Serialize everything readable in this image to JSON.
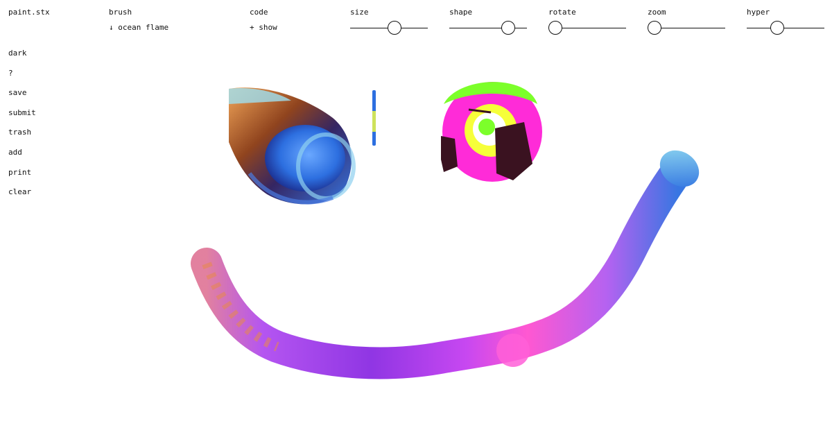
{
  "app": {
    "title": "paint.stx"
  },
  "toolbar": {
    "brush": {
      "label": "brush",
      "value": "↓ ocean flame"
    },
    "code": {
      "label": "code",
      "value": "+ show"
    },
    "sliders": [
      {
        "id": "size",
        "label": "size",
        "value": 0.48
      },
      {
        "id": "shape",
        "label": "shape",
        "value": 0.67
      },
      {
        "id": "rotate",
        "label": "rotate",
        "value": 0.0
      },
      {
        "id": "zoom",
        "label": "zoom",
        "value": 0.0
      },
      {
        "id": "hyper",
        "label": "hyper",
        "value": 0.3
      }
    ]
  },
  "menu": [
    {
      "id": "dark",
      "label": "dark"
    },
    {
      "id": "help",
      "label": "?"
    },
    {
      "id": "save",
      "label": "save"
    },
    {
      "id": "submit",
      "label": "submit"
    },
    {
      "id": "trash",
      "label": "trash"
    },
    {
      "id": "add",
      "label": "add"
    },
    {
      "id": "print",
      "label": "print"
    },
    {
      "id": "clear",
      "label": "clear"
    }
  ],
  "colors": {
    "ink": "#111111",
    "background": "#ffffff",
    "stroke_violet": "#8a2be2",
    "stroke_magenta": "#e040fb",
    "stroke_pink": "#ff4fcf",
    "stroke_blue": "#2d6fe0",
    "stroke_cyan": "#5fc4e6",
    "stroke_orange": "#e07a2a",
    "stroke_brown": "#5a2a10",
    "stroke_lime": "#7cff2a",
    "stroke_yellow": "#f6ff3a"
  }
}
